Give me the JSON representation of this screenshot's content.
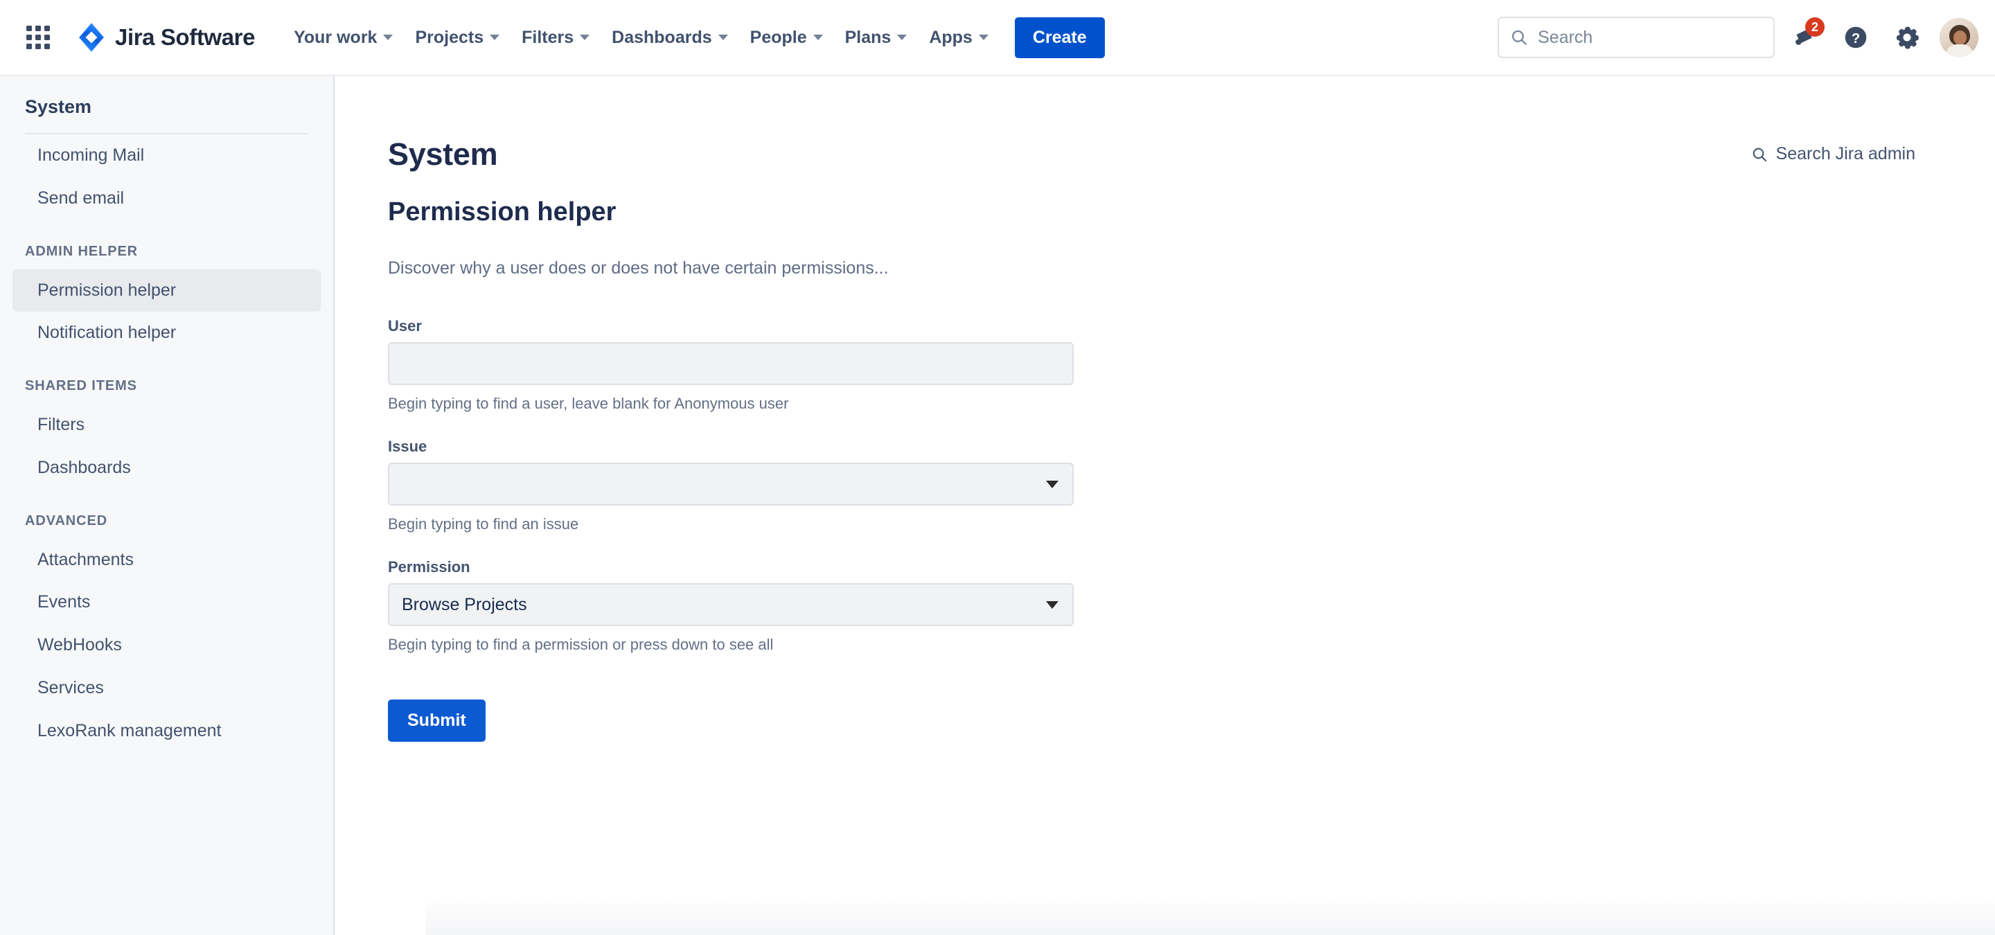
{
  "topnav": {
    "app_switcher_icon": "grid-apps-icon",
    "brand": {
      "icon": "jira-logo-icon",
      "name": "Jira Software"
    },
    "menu": [
      {
        "label": "Your work",
        "has_caret": true
      },
      {
        "label": "Projects",
        "has_caret": true
      },
      {
        "label": "Filters",
        "has_caret": true
      },
      {
        "label": "Dashboards",
        "has_caret": true
      },
      {
        "label": "People",
        "has_caret": true
      },
      {
        "label": "Plans",
        "has_caret": true
      },
      {
        "label": "Apps",
        "has_caret": true
      }
    ],
    "create_label": "Create",
    "search": {
      "icon": "search-icon",
      "value": "",
      "placeholder": "Search"
    },
    "notifications": {
      "icon": "megaphone-icon",
      "badge": "2"
    },
    "help": {
      "icon": "help-circle-icon"
    },
    "settings": {
      "icon": "gear-icon"
    },
    "avatar": {
      "icon": "avatar"
    }
  },
  "sidebar": {
    "title": "System",
    "items": [
      {
        "kind": "divider"
      },
      {
        "kind": "item",
        "label": "Incoming Mail",
        "selected": false
      },
      {
        "kind": "item",
        "label": "Send email",
        "selected": false
      },
      {
        "kind": "heading",
        "label": "ADMIN HELPER"
      },
      {
        "kind": "item",
        "label": "Permission helper",
        "selected": true
      },
      {
        "kind": "item",
        "label": "Notification helper",
        "selected": false
      },
      {
        "kind": "heading",
        "label": "SHARED ITEMS"
      },
      {
        "kind": "item",
        "label": "Filters",
        "selected": false
      },
      {
        "kind": "item",
        "label": "Dashboards",
        "selected": false
      },
      {
        "kind": "heading",
        "label": "ADVANCED"
      },
      {
        "kind": "item",
        "label": "Attachments",
        "selected": false
      },
      {
        "kind": "item",
        "label": "Events",
        "selected": false
      },
      {
        "kind": "item",
        "label": "WebHooks",
        "selected": false
      },
      {
        "kind": "item",
        "label": "Services",
        "selected": false
      },
      {
        "kind": "item",
        "label": "LexoRank management",
        "selected": false
      }
    ]
  },
  "main": {
    "page_title": "System",
    "section_title": "Permission helper",
    "lead": "Discover why a user does or does not have certain permissions...",
    "admin_search": {
      "icon": "search-icon",
      "label": "Search Jira admin"
    },
    "form": {
      "fields": [
        {
          "label": "User",
          "type": "text",
          "value": "",
          "placeholder": "",
          "hint": "Begin typing to find a user, leave blank for Anonymous user"
        },
        {
          "label": "Issue",
          "type": "select",
          "value": "",
          "placeholder": "",
          "hint": "Begin typing to find an issue"
        },
        {
          "label": "Permission",
          "type": "select",
          "value": "Browse Projects",
          "placeholder": "",
          "hint": "Begin typing to find a permission or press down to see all"
        }
      ],
      "submit_label": "Submit"
    }
  },
  "colors": {
    "brand_blue": "#0052cc",
    "submit_blue": "#0c5ad2",
    "badge_red": "#d73a1f",
    "sidebar_bg": "#f7f8f9",
    "selected_bg": "#e9eaee",
    "text_dark": "#172b4d",
    "text_muted": "#626f86"
  }
}
